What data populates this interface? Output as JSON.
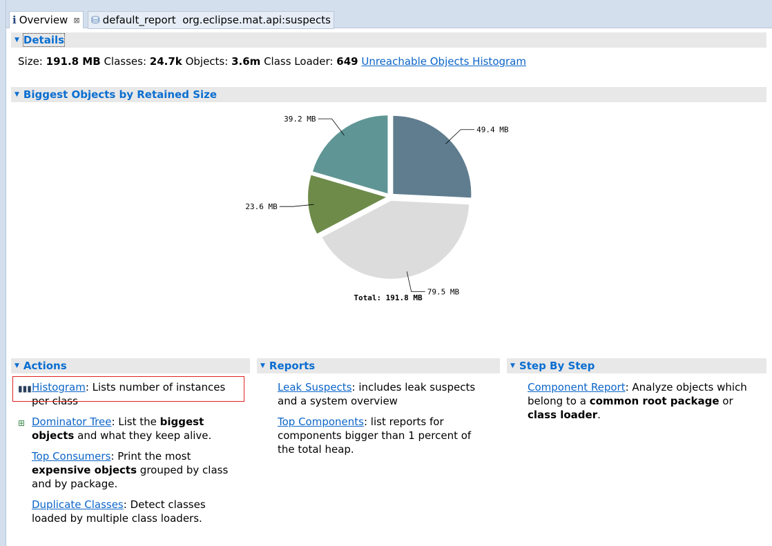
{
  "tabs": [
    {
      "label": "Overview",
      "icon": "info-icon",
      "active": true
    },
    {
      "label": "default_report  org.eclipse.mat.api:suspects",
      "icon": "report-icon"
    }
  ],
  "details": {
    "title": "Details",
    "size_label": "Size:",
    "size": "191.8 MB",
    "classes_label": "Classes:",
    "classes": "24.7k",
    "objects_label": "Objects:",
    "objects": "3.6m",
    "loader_label": "Class Loader:",
    "loader": "649",
    "link": "Unreachable Objects Histogram"
  },
  "biggest": {
    "title": "Biggest Objects by Retained Size"
  },
  "chart_data": {
    "type": "pie",
    "unit": "MB",
    "slices": [
      {
        "label": "49.4 MB",
        "value": 49.4,
        "color": "#5f7d8f"
      },
      {
        "label": "79.5 MB",
        "value": 79.5,
        "color": "#dcdcdc"
      },
      {
        "label": "23.6 MB",
        "value": 23.6,
        "color": "#6e8b4a"
      },
      {
        "label": "39.2 MB",
        "value": 39.2,
        "color": "#5f9595"
      }
    ],
    "total_label": "Total: 191.8 MB"
  },
  "actions": {
    "title": "Actions",
    "items": [
      {
        "link": "Histogram",
        "text1": ": Lists number of instances per class",
        "icon": "histogram-icon"
      },
      {
        "link": "Dominator Tree",
        "text1": ": List the ",
        "bold": "biggest objects",
        "text2": " and what they keep alive.",
        "icon": "dominator-tree-icon"
      },
      {
        "link": "Top Consumers",
        "text1": ": Print the most ",
        "bold": "expensive objects",
        "text2": " grouped by class and by package."
      },
      {
        "link": "Duplicate Classes",
        "text1": ": Detect classes loaded by multiple class loaders."
      }
    ]
  },
  "reports": {
    "title": "Reports",
    "items": [
      {
        "link": "Leak Suspects",
        "text1": ": includes leak suspects and a system overview"
      },
      {
        "link": "Top Components",
        "text1": ": list reports for components bigger than 1 percent of the total heap."
      }
    ]
  },
  "steps": {
    "title": "Step By Step",
    "items": [
      {
        "link": "Component Report",
        "text1": ": Analyze objects which belong to a ",
        "bold": "common root package",
        "text2": " or ",
        "bold2": "class loader",
        "text3": "."
      }
    ]
  }
}
